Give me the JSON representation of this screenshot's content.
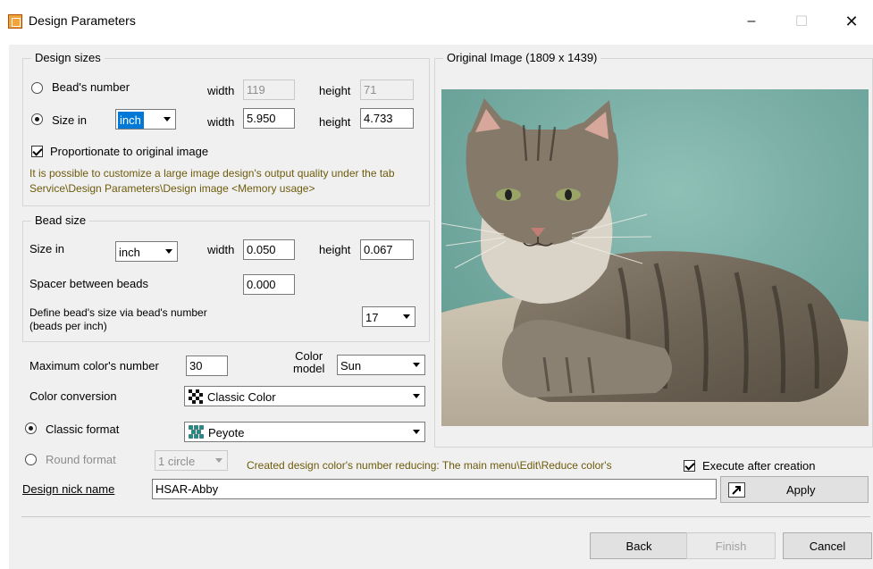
{
  "window": {
    "title": "Design Parameters",
    "minimize": "–",
    "maximize": "☐",
    "close": "✕"
  },
  "design_sizes": {
    "legend": "Design sizes",
    "beads_number_label": "Bead's number",
    "width_label": "width",
    "height_label": "height",
    "beads_width": "119",
    "beads_height": "71",
    "size_in_label": "Size in",
    "size_unit": "inch",
    "size_width": "5.950",
    "size_height": "4.733",
    "proportionate_label": "Proportionate to original image",
    "note": "It is possible to customize a large image design's output quality under the tab Service\\Design Parameters\\Design image <Memory usage>"
  },
  "bead_size": {
    "legend": "Bead size",
    "size_in_label": "Size in",
    "unit": "inch",
    "width_label": "width",
    "width": "0.050",
    "height_label": "height",
    "height": "0.067",
    "spacer_label": "Spacer between beads",
    "spacer": "0.000",
    "define_label_1": "Define bead's size via bead's number",
    "define_label_2": "(beads per inch)",
    "beads_per_inch": "17"
  },
  "colors": {
    "max_label": "Maximum color's number",
    "max_value": "30",
    "model_label_1": "Color",
    "model_label_2": "model",
    "model_value": "Sun",
    "conversion_label": "Color conversion",
    "conversion_value": "Classic Color"
  },
  "format": {
    "classic_label": "Classic format",
    "classic_value": "Peyote",
    "round_label": "Round format",
    "round_value": "1 circle",
    "reduce_note": "Created design color's number reducing: The main menu\\Edit\\Reduce color's",
    "execute_label": "Execute after creation"
  },
  "nick": {
    "label": "Design nick name",
    "value": "HSAR-Abby",
    "apply": "Apply"
  },
  "preview": {
    "legend": "Original Image (1809 x 1439)"
  },
  "footer": {
    "back": "Back",
    "finish": "Finish",
    "cancel": "Cancel"
  }
}
